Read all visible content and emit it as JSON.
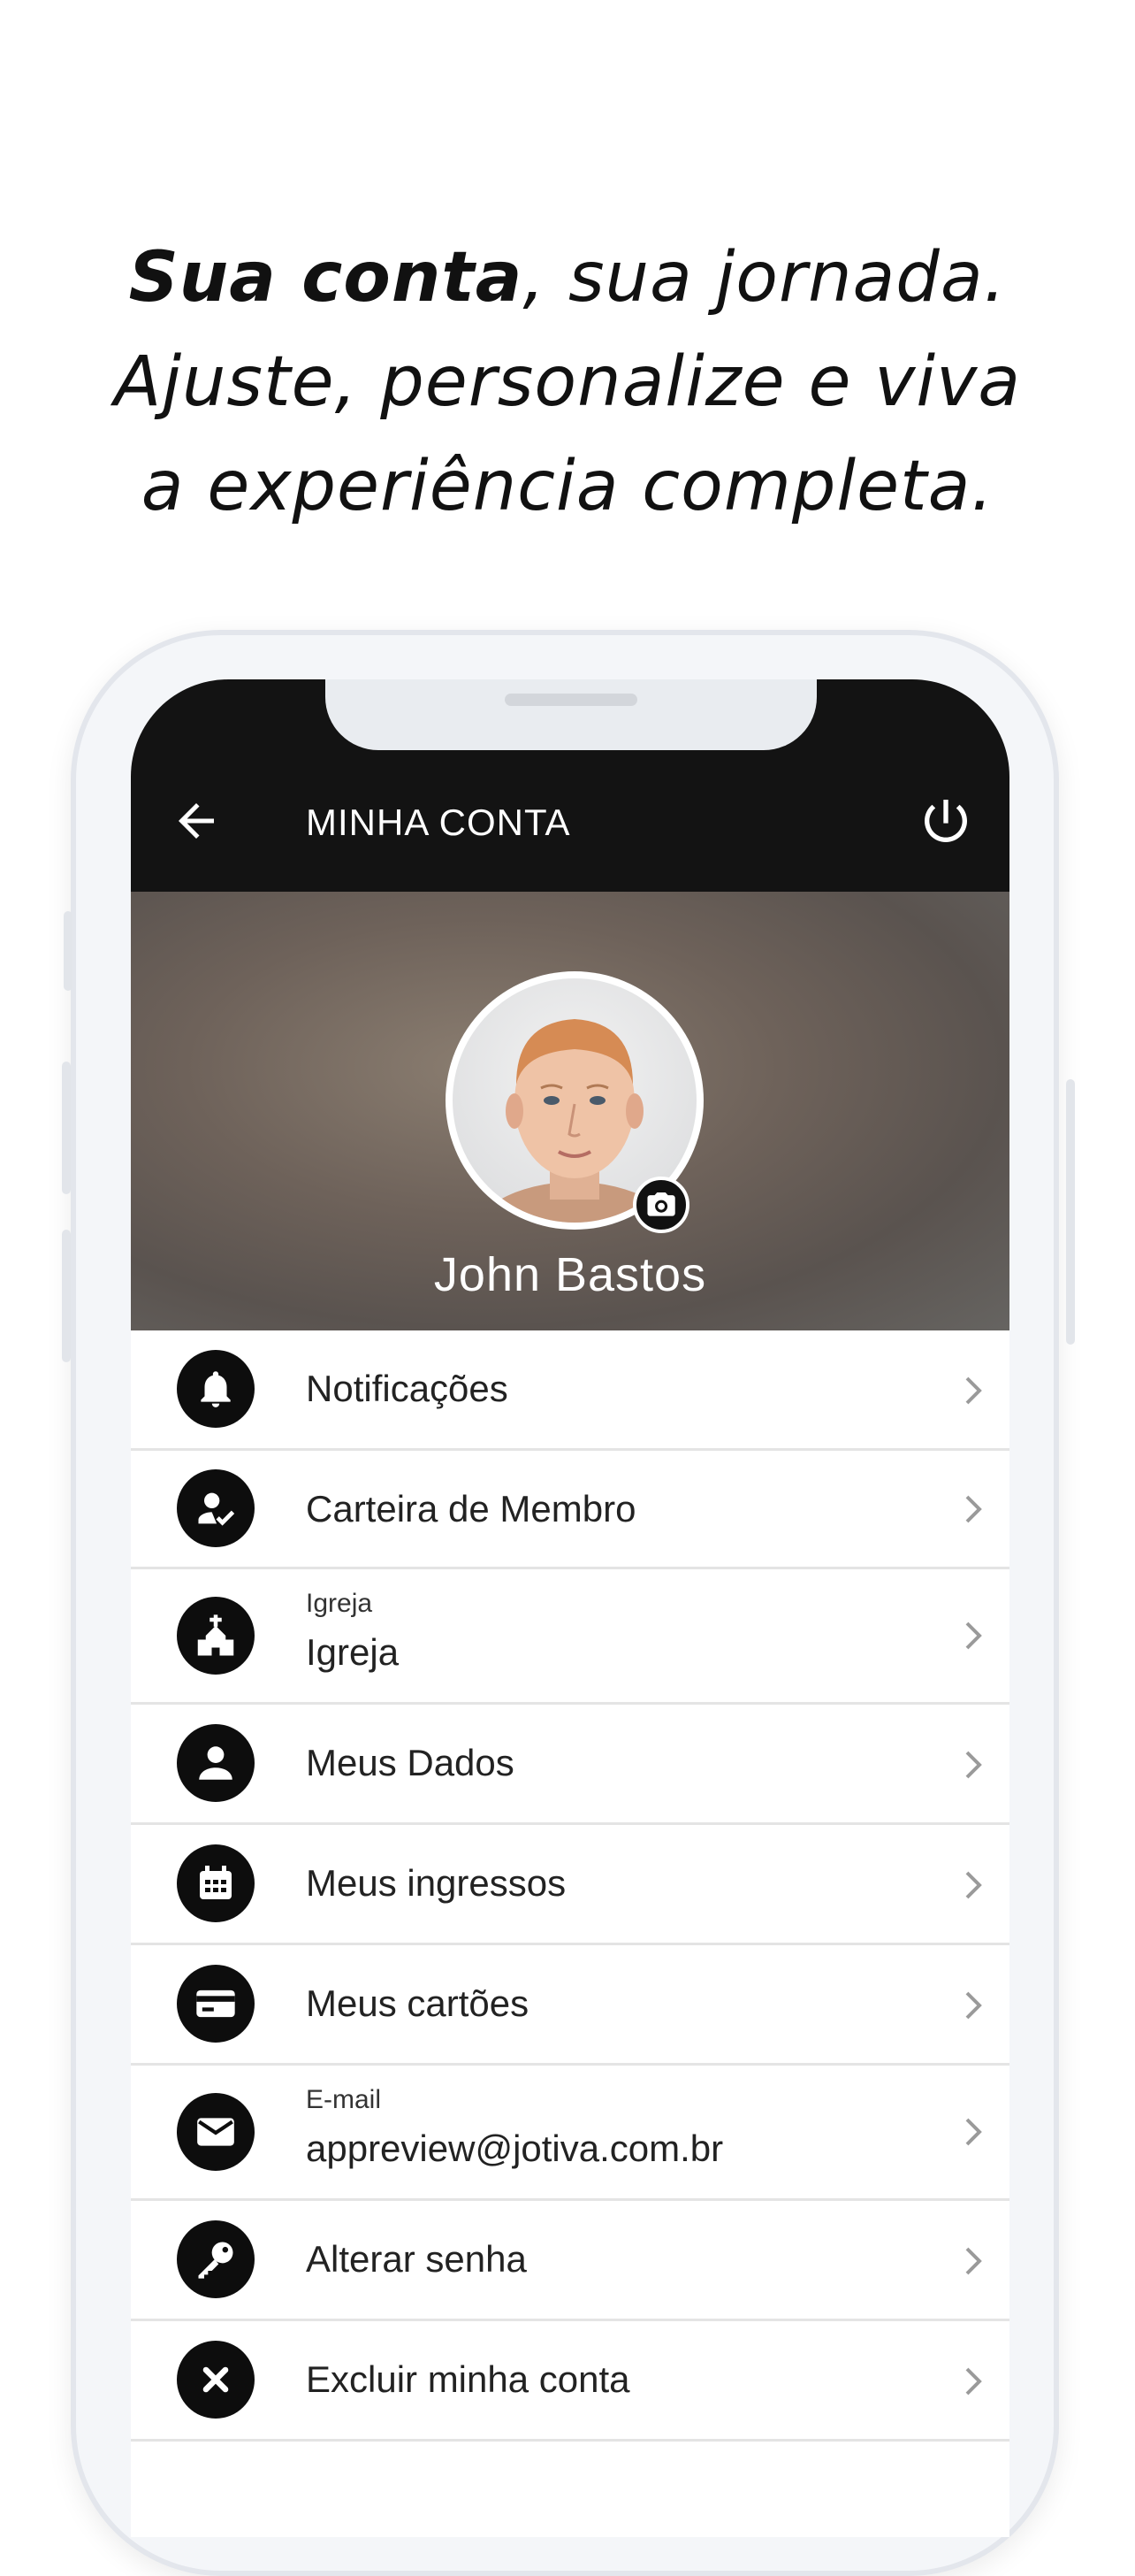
{
  "headline": {
    "bold": "Sua conta",
    "line1_rest": ", sua jornada.",
    "line2": "Ajuste, personalize e viva",
    "line3": "a experiência completa."
  },
  "appbar": {
    "title": "MINHA CONTA",
    "back_icon": "arrow-left-icon",
    "power_icon": "power-icon"
  },
  "profile": {
    "name": "John Bastos",
    "camera_icon": "camera-icon"
  },
  "menu": [
    {
      "icon": "bell-icon",
      "label": "Notificações",
      "sub": ""
    },
    {
      "icon": "member-card-icon",
      "label": "Carteira de Membro",
      "sub": ""
    },
    {
      "icon": "church-icon",
      "label": "Igreja",
      "sub": "Igreja"
    },
    {
      "icon": "person-icon",
      "label": "Meus Dados",
      "sub": ""
    },
    {
      "icon": "calendar-icon",
      "label": "Meus ingressos",
      "sub": ""
    },
    {
      "icon": "credit-card-icon",
      "label": "Meus cartões",
      "sub": ""
    },
    {
      "icon": "mail-icon",
      "label": "appreview@jotiva.com.br",
      "sub": "E-mail"
    },
    {
      "icon": "key-icon",
      "label": "Alterar senha",
      "sub": ""
    },
    {
      "icon": "close-icon",
      "label": "Excluir minha conta",
      "sub": ""
    }
  ],
  "colors": {
    "appbar": "#131313",
    "icon_circle": "#0d0d0d",
    "chevron": "#9a9a9a"
  }
}
